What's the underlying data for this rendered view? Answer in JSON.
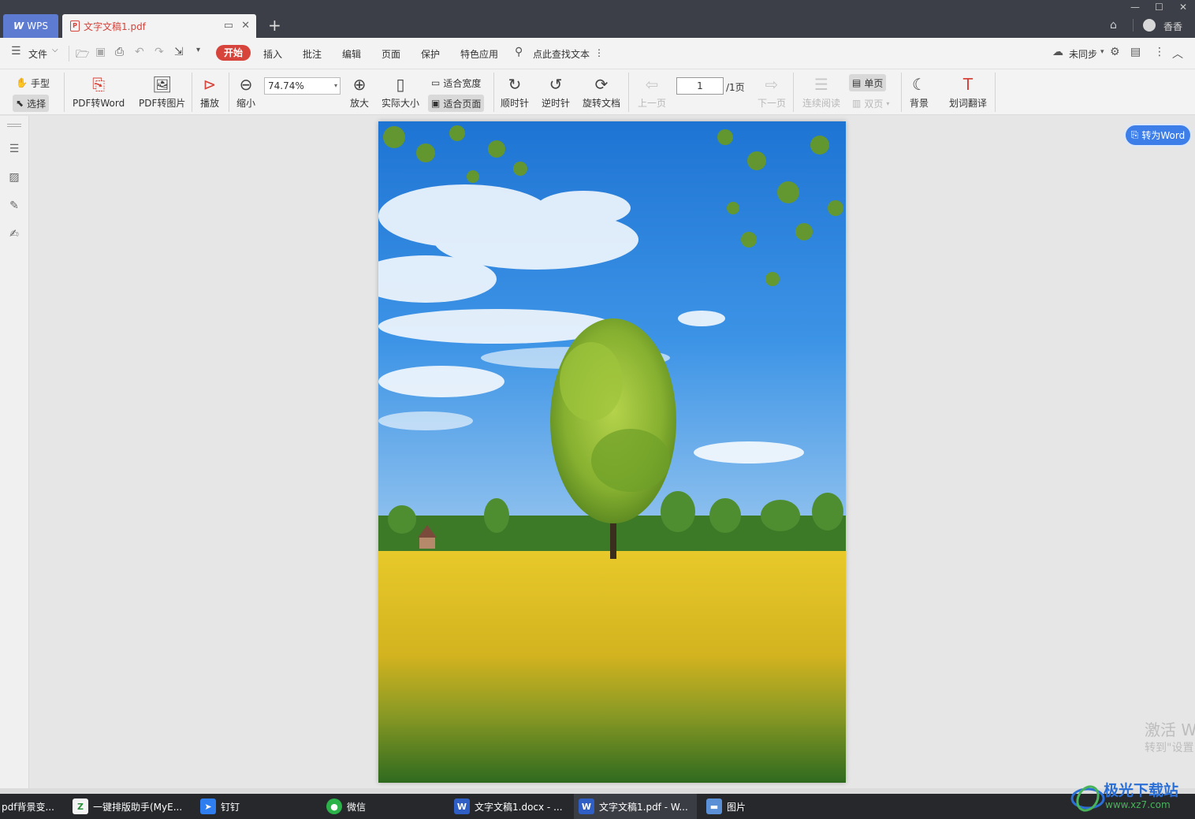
{
  "titlebar": {
    "wps_label": "WPS",
    "doc_tab_label": "文字文稿1.pdf",
    "user_name": "香香"
  },
  "menu": {
    "file": "文件",
    "start": "开始",
    "items": [
      "插入",
      "批注",
      "编辑",
      "页面",
      "保护",
      "特色应用"
    ],
    "search": "点此查找文本",
    "sync": "未同步"
  },
  "toolbar": {
    "hand": "手型",
    "select": "选择",
    "pdf_to_word": "PDF转Word",
    "pdf_to_image": "PDF转图片",
    "play": "播放",
    "zoom_out": "缩小",
    "zoom_value": "74.74%",
    "zoom_in": "放大",
    "actual_size": "实际大小",
    "fit_width": "适合宽度",
    "fit_page": "适合页面",
    "clockwise": "顺时针",
    "counter_clockwise": "逆时针",
    "rotate_doc": "旋转文档",
    "prev_page": "上一页",
    "page_current": "1",
    "page_total": "/1页",
    "next_page": "下一页",
    "continuous": "连续阅读",
    "single_page": "单页",
    "double_page": "双页",
    "background": "背景",
    "translate": "划词翻译"
  },
  "content": {
    "to_word": "转为Word",
    "watermark_line1": "激活 W",
    "watermark_line2": "转到\"设置"
  },
  "taskbar": {
    "items": [
      "pdf背景变...",
      "一键排版助手(MyE...",
      "钉钉",
      "微信",
      "文字文稿1.docx - ...",
      "文字文稿1.pdf - W...",
      "图片"
    ]
  },
  "brand": {
    "name": "极光下载站",
    "url": "www.xz7.com"
  },
  "colors": {
    "accent_red": "#d6443b",
    "accent_blue": "#3d7ee8"
  }
}
